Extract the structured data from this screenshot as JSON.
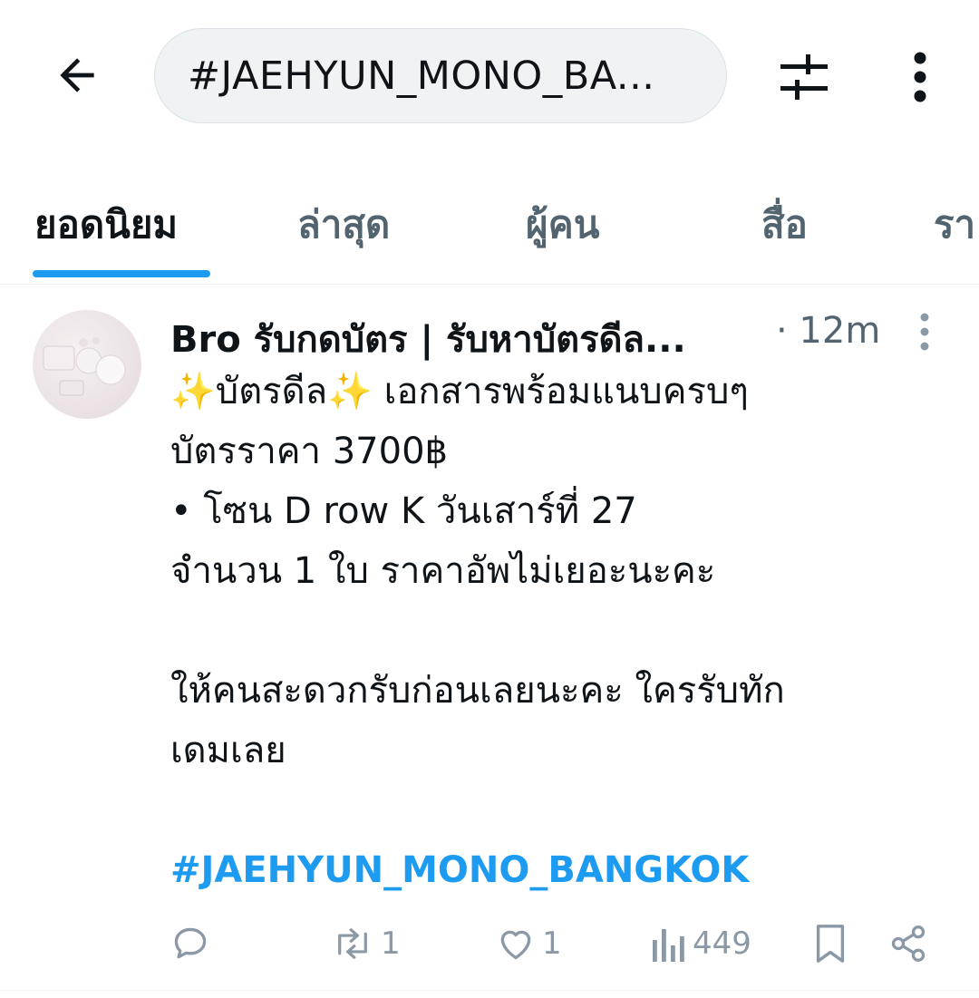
{
  "search": {
    "query": "#JAEHYUN_MONO_BA..."
  },
  "icons": {
    "back": "arrow-left-icon",
    "filter": "sliders-icon",
    "more": "more-vertical-icon",
    "reply": "comment-icon",
    "repost": "retweet-icon",
    "like": "heart-icon",
    "views": "bar-chart-icon",
    "bookmark": "bookmark-icon",
    "share": "share-icon"
  },
  "tabs": [
    {
      "label": "ยอดนิยม",
      "active": true
    },
    {
      "label": "ล่าสุด"
    },
    {
      "label": "ผู้คน"
    },
    {
      "label": "สื่อ"
    },
    {
      "label": "รา"
    }
  ],
  "post": {
    "author": "Bro รับกดบัตร | รับหาบัตรดีล...",
    "time": "· 12m",
    "lines": [
      "✨บัตรดีล✨ เอกสารพร้อมแนบครบๆ",
      "บัตรราคา 3700฿",
      "• โซน D row K วันเสาร์ที่ 27",
      "จำนวน 1 ใบ ราคาอัพไม่เยอะนะคะ",
      "",
      "ให้คนสะดวกรับก่อนเลยนะคะ ใครรับทัก",
      "เดมเลย",
      ""
    ],
    "hashtag": "#JAEHYUN_MONO_BANGKOK",
    "stats": {
      "reposts": "1",
      "likes": "1",
      "views": "449"
    }
  },
  "colors": {
    "accent": "#1d9bf0",
    "muted": "#536471",
    "text": "#0f1419"
  }
}
